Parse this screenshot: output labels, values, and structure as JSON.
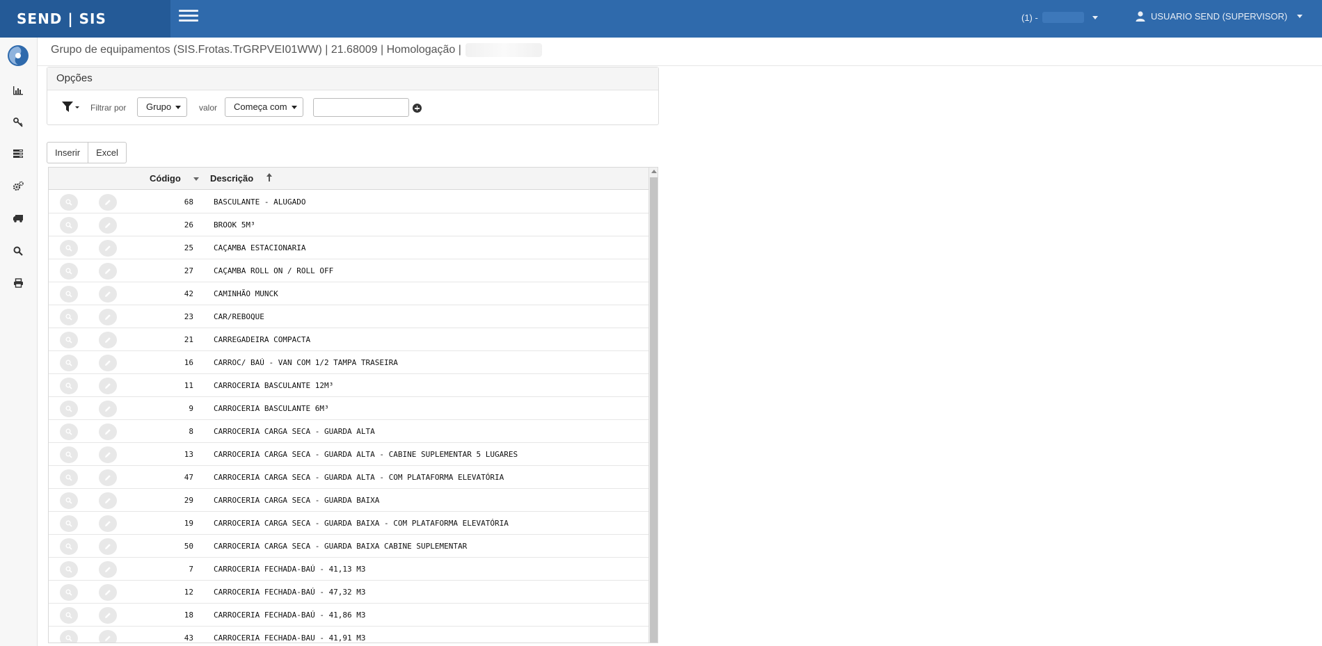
{
  "header": {
    "brand": "SEND | SIS",
    "company_label": "(1) -",
    "user_label": "USUARIO SEND (SUPERVISOR)"
  },
  "page": {
    "title": "Grupo de equipamentos (SIS.Frotas.TrGRPVEI01WW) | 21.68009 | Homologação |"
  },
  "options": {
    "heading": "Opções",
    "filter_by_label": "Filtrar por",
    "filter_field_value": "Grupo",
    "value_label": "valor",
    "operator_value": "Começa com",
    "search_value": ""
  },
  "toolbar": {
    "insert_label": "Inserir",
    "excel_label": "Excel"
  },
  "grid": {
    "columns": {
      "code": "Código",
      "description": "Descrição"
    },
    "rows": [
      {
        "code": "68",
        "description": "BASCULANTE - ALUGADO"
      },
      {
        "code": "26",
        "description": "BROOK 5M³"
      },
      {
        "code": "25",
        "description": "CAÇAMBA ESTACIONARIA"
      },
      {
        "code": "27",
        "description": "CAÇAMBA ROLL ON / ROLL OFF"
      },
      {
        "code": "42",
        "description": "CAMINHÃO MUNCK"
      },
      {
        "code": "23",
        "description": "CAR/REBOQUE"
      },
      {
        "code": "21",
        "description": "CARREGADEIRA COMPACTA"
      },
      {
        "code": "16",
        "description": "CARROC/ BAÚ - VAN COM 1/2 TAMPA TRASEIRA"
      },
      {
        "code": "11",
        "description": "CARROCERIA BASCULANTE 12M³"
      },
      {
        "code": "9",
        "description": "CARROCERIA BASCULANTE 6M³"
      },
      {
        "code": "8",
        "description": "CARROCERIA CARGA SECA - GUARDA ALTA"
      },
      {
        "code": "13",
        "description": "CARROCERIA CARGA SECA - GUARDA ALTA - CABINE SUPLEMENTAR 5 LUGARES"
      },
      {
        "code": "47",
        "description": "CARROCERIA CARGA SECA - GUARDA ALTA - COM PLATAFORMA ELEVATÓRIA"
      },
      {
        "code": "29",
        "description": "CARROCERIA CARGA SECA - GUARDA BAIXA"
      },
      {
        "code": "19",
        "description": "CARROCERIA CARGA SECA - GUARDA BAIXA - COM PLATAFORMA ELEVATÓRIA"
      },
      {
        "code": "50",
        "description": "CARROCERIA CARGA SECA - GUARDA BAIXA CABINE SUPLEMENTAR"
      },
      {
        "code": "7",
        "description": "CARROCERIA FECHADA-BAÚ - 41,13 M3"
      },
      {
        "code": "12",
        "description": "CARROCERIA FECHADA-BAÚ - 47,32 M3"
      },
      {
        "code": "18",
        "description": "CARROCERIA FECHADA-BAÚ - 41,86 M3"
      },
      {
        "code": "43",
        "description": "CARROCERIA FECHADA-BAU - 41,91 M3"
      }
    ]
  }
}
